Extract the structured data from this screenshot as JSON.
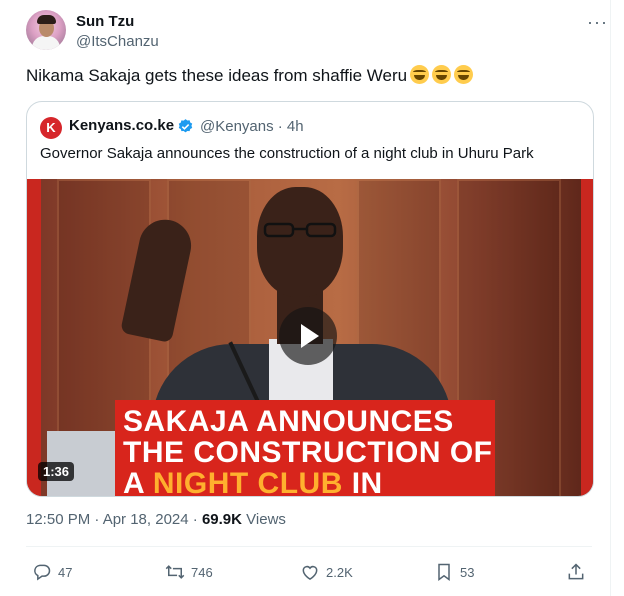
{
  "tweet": {
    "display_name": "Sun Tzu",
    "handle": "@ItsChanzu",
    "text": "Nikama Sakaja gets these ideas from shaffie Weru",
    "emojis": [
      "face-with-tears-of-joy",
      "face-with-tears-of-joy",
      "face-with-tears-of-joy"
    ],
    "more_label": "···",
    "timestamp": "12:50 PM · Apr 18, 2024",
    "views_count": "69.9K",
    "views_label": "Views"
  },
  "quoted": {
    "logo_letter": "K",
    "name": "Kenyans.co.ke",
    "handle_time": "@Kenyans · 4h",
    "text": "Governor Sakaja announces the construction of a night club in Uhuru Park",
    "video": {
      "duration": "1:36",
      "banner_line1": "SAKAJA ANNOUNCES",
      "banner_line2": "THE CONSTRUCTION OF",
      "banner_line3_a": "A ",
      "banner_line3_b": "NIGHT CLUB",
      "banner_line3_c": " IN",
      "banner_accent": "#ffb02e",
      "banner_color": "#d8251c"
    }
  },
  "actions": {
    "replies": "47",
    "reposts": "746",
    "likes": "2.2K",
    "bookmarks": "53"
  },
  "colors": {
    "text": "#0f1419",
    "secondary": "#536471",
    "verified": "#1d9bf0",
    "border": "#cfd9de"
  }
}
